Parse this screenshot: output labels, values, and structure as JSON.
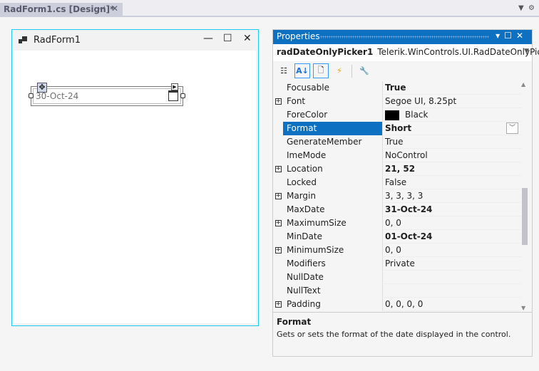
{
  "tab": {
    "title": "RadForm1.cs [Design]*",
    "pin": "⊣",
    "close": "✕"
  },
  "form": {
    "title": "RadForm1",
    "minimize": "—",
    "maximize": "☐",
    "close": "✕",
    "picker_value": "30-Oct-24"
  },
  "properties": {
    "title": "Properties",
    "object_name": "radDateOnlyPicker1",
    "object_type": "Telerik.WinControls.UI.RadDateOnlyPicker",
    "rows": [
      {
        "name": "Focusable",
        "value": "True",
        "bold": true
      },
      {
        "name": "Font",
        "value": "Segoe UI, 8.25pt",
        "expand": true
      },
      {
        "name": "ForeColor",
        "value": "Black",
        "swatch": "#000000"
      },
      {
        "name": "Format",
        "value": "Short",
        "bold": true,
        "selected": true
      },
      {
        "name": "GenerateMember",
        "value": "True"
      },
      {
        "name": "ImeMode",
        "value": "NoControl"
      },
      {
        "name": "Location",
        "value": "21, 52",
        "bold": true,
        "expand": true
      },
      {
        "name": "Locked",
        "value": "False"
      },
      {
        "name": "Margin",
        "value": "3, 3, 3, 3",
        "expand": true
      },
      {
        "name": "MaxDate",
        "value": "31-Oct-24",
        "bold": true
      },
      {
        "name": "MaximumSize",
        "value": "0, 0",
        "expand": true
      },
      {
        "name": "MinDate",
        "value": "01-Oct-24",
        "bold": true
      },
      {
        "name": "MinimumSize",
        "value": "0, 0",
        "expand": true
      },
      {
        "name": "Modifiers",
        "value": "Private"
      },
      {
        "name": "NullDate",
        "value": ""
      },
      {
        "name": "NullText",
        "value": ""
      },
      {
        "name": "Padding",
        "value": "0, 0, 0, 0",
        "expand": true
      }
    ],
    "description_title": "Format",
    "description_text": "Gets or sets the format of the date displayed in the control."
  },
  "colors": {
    "accent": "#0e70c0",
    "form_border": "#1ec8f0"
  }
}
